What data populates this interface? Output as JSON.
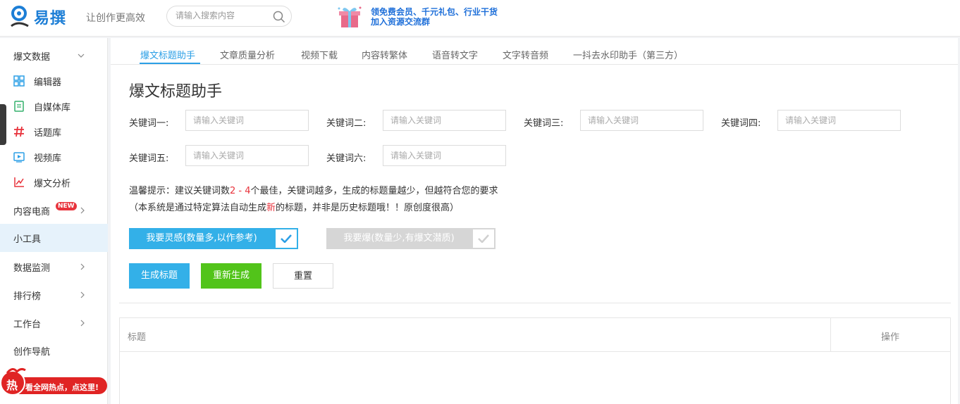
{
  "header": {
    "logo_text": "易撰",
    "slogan": "让创作更高效",
    "search_placeholder": "请输入搜索内容",
    "promo_line1": "领免费会员、千元礼包、行业干货",
    "promo_line2": "加入资源交流群"
  },
  "sidebar": {
    "items": [
      {
        "label": "爆文数据",
        "icon": "chevron-down"
      },
      {
        "label": "编辑器",
        "icon": "grid-icon",
        "color": "#2b9fe6"
      },
      {
        "label": "自媒体库",
        "icon": "document-icon",
        "color": "#33b06b"
      },
      {
        "label": "话题库",
        "icon": "hash-icon",
        "color": "#e8333c"
      },
      {
        "label": "视频库",
        "icon": "play-icon",
        "color": "#2b9fe6"
      },
      {
        "label": "爆文分析",
        "icon": "chart-icon",
        "color": "#e8333c"
      },
      {
        "label": "内容电商",
        "badge": "NEW"
      },
      {
        "label": "小工具"
      },
      {
        "label": "数据监测"
      },
      {
        "label": "排行榜"
      },
      {
        "label": "工作台"
      },
      {
        "label": "创作导航"
      }
    ],
    "hot_badge": "热",
    "hot_text": "看全网热点，点这里!"
  },
  "tabs": [
    "爆文标题助手",
    "文章质量分析",
    "视频下载",
    "内容转繁体",
    "语音转文字",
    "文字转音频",
    "一抖去水印助手（第三方）"
  ],
  "main": {
    "title": "爆文标题助手",
    "keywords": [
      {
        "label": "关键词一:",
        "placeholder": "请输入关键词"
      },
      {
        "label": "关键词二:",
        "placeholder": "请输入关键词"
      },
      {
        "label": "关键词三:",
        "placeholder": "请输入关键词"
      },
      {
        "label": "关键词四:",
        "placeholder": "请输入关键词"
      },
      {
        "label": "关键词五:",
        "placeholder": "请输入关键词"
      },
      {
        "label": "关键词六:",
        "placeholder": "请输入关键词"
      }
    ],
    "tip1_a": "温馨提示：建议关键词数",
    "tip1_range": "2 - 4",
    "tip1_b": "个最佳，关键词越多，生成的标题量越少，但越符合您的要求",
    "tip2_a": "（本系统是通过特定算法自动生成",
    "tip2_new": "新",
    "tip2_b": "的标题，并非是历史标题哦！！原创度很高）",
    "mode_inspire": "我要灵感(数量多,以作参考)",
    "mode_viral": "我要爆(数量少,有爆文潜质)",
    "btn_generate": "生成标题",
    "btn_regenerate": "重新生成",
    "btn_reset": "重置",
    "table_col_title": "标题",
    "table_col_action": "操作"
  },
  "colors": {
    "accent": "#2b9fe6",
    "green": "#52c41a",
    "red": "#e8333c"
  }
}
